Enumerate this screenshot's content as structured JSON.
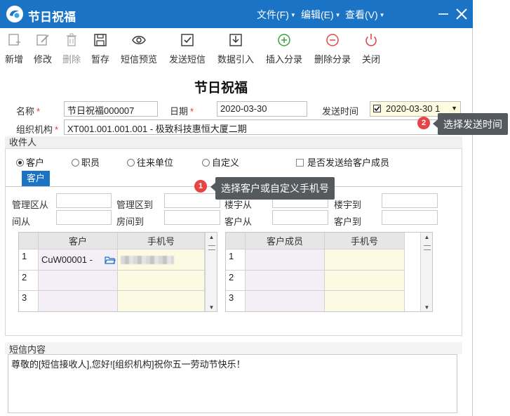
{
  "window": {
    "title": "节日祝福",
    "menus": [
      "文件(F)",
      "编辑(E)",
      "查看(V)"
    ],
    "accent_color": "#1a73c5"
  },
  "toolbar": {
    "buttons": [
      {
        "label": "新增",
        "icon": "add-doc-icon"
      },
      {
        "label": "修改",
        "icon": "edit-icon"
      },
      {
        "label": "删除",
        "icon": "trash-icon"
      },
      {
        "label": "暂存",
        "icon": "save-icon"
      },
      {
        "label": "短信预览",
        "icon": "eye-icon"
      },
      {
        "label": "发送短信",
        "icon": "send-check-icon"
      },
      {
        "label": "数据引入",
        "icon": "import-icon"
      },
      {
        "label": "插入分录",
        "icon": "plus-circle-icon"
      },
      {
        "label": "删除分录",
        "icon": "minus-circle-icon"
      },
      {
        "label": "关闭",
        "icon": "power-icon"
      }
    ]
  },
  "form": {
    "doc_title": "节日祝福",
    "name_label": "名称",
    "name_value": "节日祝福000007",
    "date_label": "日期",
    "date_value": "2020-03-30",
    "send_time_label": "发送时间",
    "send_time_value": "2020-03-30 1",
    "org_label": "组织机构",
    "org_value": "XT001.001.001.001 - 极致科技惠恒大厦二期",
    "required_mark": "*"
  },
  "tooltips": {
    "send_time": {
      "badge": "2",
      "text": "选择发送时间"
    },
    "customer": {
      "badge": "1",
      "text": "选择客户或自定义手机号"
    }
  },
  "recipients": {
    "section_title": "收件人",
    "radio_options": [
      "客户",
      "职员",
      "往来单位",
      "自定义"
    ],
    "selected_radio": "客户",
    "send_members_label": "是否发送给客户成员",
    "tab_label": "客户",
    "filters_row1": [
      "管理区从",
      "管理区到",
      "楼宇从",
      "楼宇到"
    ],
    "filters_row2": [
      "房间从",
      "房间到",
      "客户从",
      "客户到"
    ],
    "left_grid": {
      "headers": [
        "客户",
        "手机号"
      ],
      "rows": [
        {
          "no": "1",
          "customer": "CuW00001 -",
          "phone": ""
        },
        {
          "no": "2",
          "customer": "",
          "phone": ""
        },
        {
          "no": "3",
          "customer": "",
          "phone": ""
        }
      ]
    },
    "right_grid": {
      "headers": [
        "客户成员",
        "手机号"
      ],
      "rows": [
        {
          "no": "1",
          "member": "",
          "phone": ""
        },
        {
          "no": "2",
          "member": "",
          "phone": ""
        },
        {
          "no": "3",
          "member": "",
          "phone": ""
        }
      ]
    }
  },
  "sms": {
    "section_title": "短信内容",
    "content": "尊敬的[短信接收人],您好![组织机构]祝你五一劳动节快乐！"
  }
}
